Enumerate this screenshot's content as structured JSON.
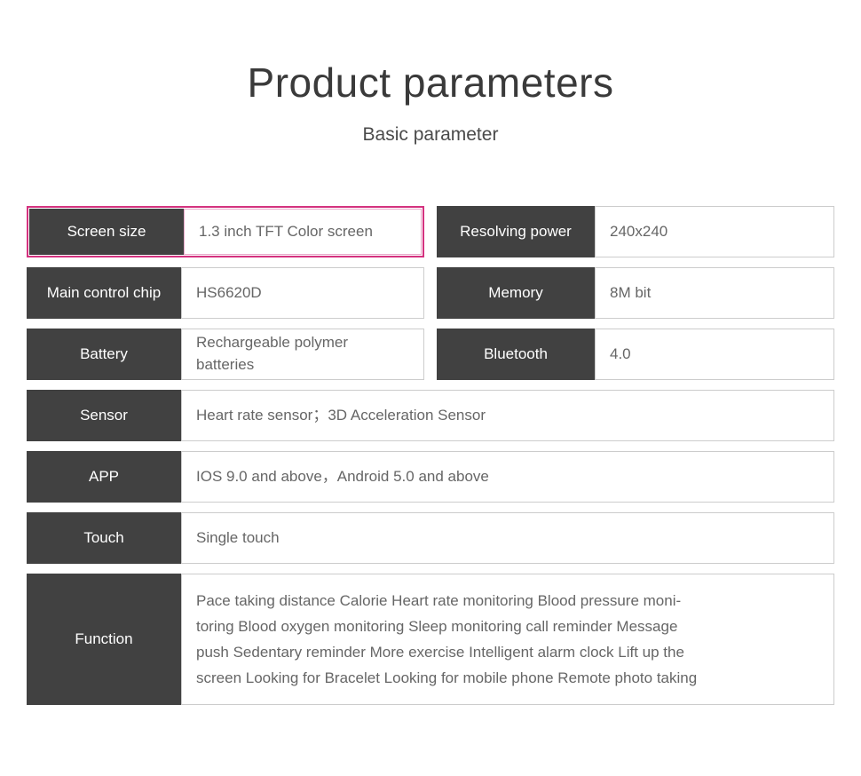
{
  "header": {
    "title": "Product parameters",
    "subtitle": "Basic parameter"
  },
  "colors": {
    "label_bg": "#414141",
    "label_text": "#ffffff",
    "value_text": "#666666",
    "value_border": "#cccccc",
    "highlight_border": "#d4327f",
    "page_bg": "#ffffff"
  },
  "spec_rows": {
    "paired": [
      {
        "left": {
          "label": "Screen size",
          "value": "1.3  inch TFT Color screen",
          "highlighted": true
        },
        "right": {
          "label": "Resolving power",
          "value": "240x240",
          "highlighted": false
        }
      },
      {
        "left": {
          "label": "Main control chip",
          "value": "HS6620D",
          "highlighted": false
        },
        "right": {
          "label": "Memory",
          "value": "8M bit",
          "highlighted": false
        }
      },
      {
        "left": {
          "label": "Battery",
          "value": "Rechargeable polymer\nbatteries",
          "highlighted": false
        },
        "right": {
          "label": "Bluetooth",
          "value": "4.0",
          "highlighted": false
        }
      }
    ],
    "full": [
      {
        "label": "Sensor",
        "value": "Heart rate sensor；3D Acceleration Sensor"
      },
      {
        "label": "APP",
        "value": "IOS 9.0 and above，Android 5.0 and above"
      },
      {
        "label": "Touch",
        "value": "Single touch"
      }
    ],
    "function": {
      "label": "Function",
      "value": "Pace taking  distance  Calorie  Heart rate monitoring  Blood pressure moni-\ntoring  Blood oxygen monitoring  Sleep monitoring  call reminder  Message\npush  Sedentary reminder  More exercise  Intelligent alarm clock Lift up the\nscreen  Looking for Bracelet  Looking for mobile phone  Remote photo taking"
    }
  }
}
